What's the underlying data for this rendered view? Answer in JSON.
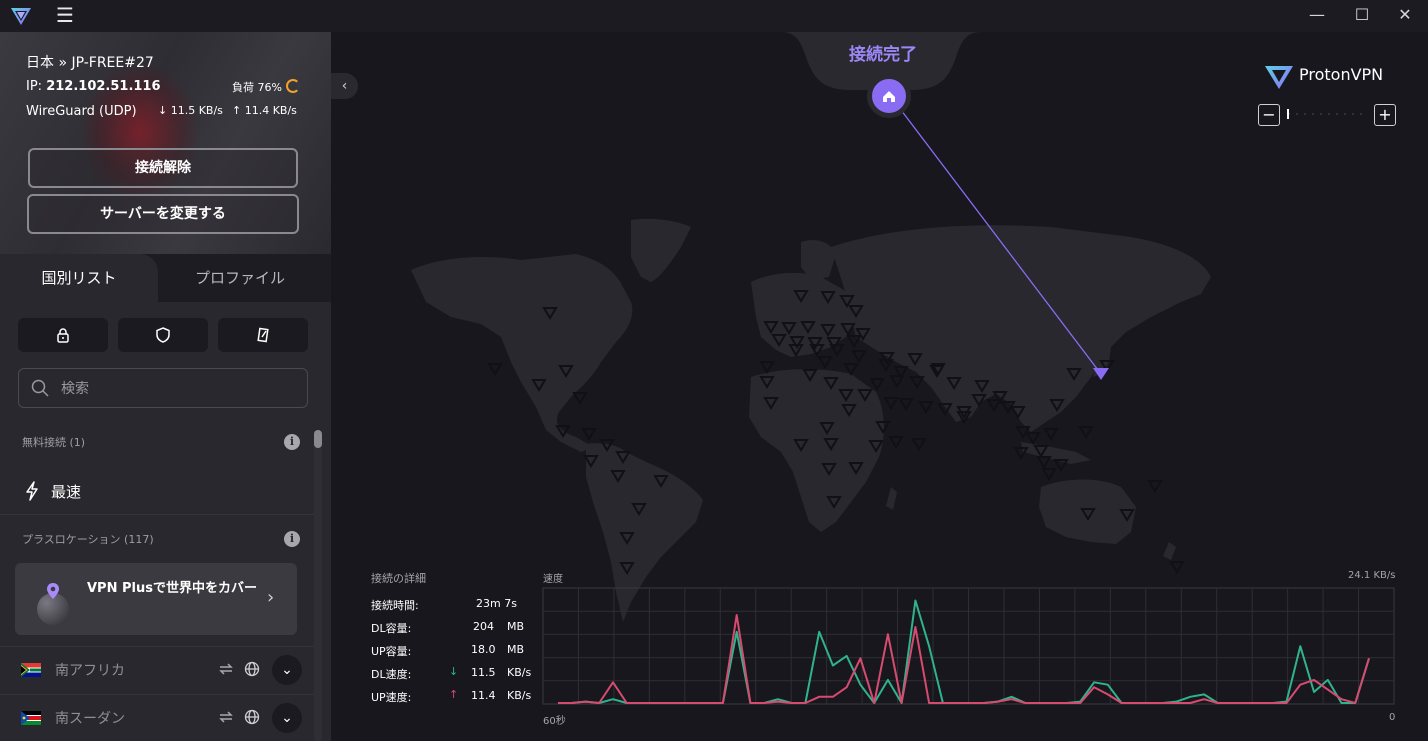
{
  "window": {
    "menu_icon": "hamburger-icon",
    "controls": [
      "minimize-icon",
      "maximize-icon",
      "close-icon"
    ]
  },
  "connection": {
    "server": "日本 » JP-FREE#27",
    "ip_label": "IP:",
    "ip": "212.102.51.116",
    "load_label": "負荷 76%",
    "load_percent": 76,
    "protocol": "WireGuard (UDP)",
    "download_rate": "↓ 11.5 KB/s",
    "upload_rate": "↑ 11.4 KB/s",
    "disconnect_label": "接続解除",
    "change_server_label": "サーバーを変更する"
  },
  "tabs": {
    "countries": "国別リスト",
    "profiles": "プロファイル"
  },
  "filters": [
    "lock-icon",
    "shield-icon",
    "p2p-icon"
  ],
  "search": {
    "placeholder": "検索"
  },
  "free_section": {
    "title": "無料接続 (1)",
    "fastest_label": "最速"
  },
  "plus_section": {
    "title": "プラスロケーション (117)",
    "promo_text": "VPN Plusで世界中をカバー"
  },
  "countries": [
    {
      "name": "南アフリカ"
    },
    {
      "name": "南スーダン"
    }
  ],
  "map": {
    "status": "接続完了",
    "brand": "ProtonVPN",
    "accent_color": "#8a6cf4"
  },
  "details": {
    "title": "接続の詳細",
    "duration_label": "接続時間:",
    "duration": "23m 7s",
    "dl_volume_label": "DL容量:",
    "dl_volume": "204",
    "dl_volume_unit": "MB",
    "ul_volume_label": "UP容量:",
    "ul_volume": "18.0",
    "ul_volume_unit": "MB",
    "dl_speed_label": "DL速度:",
    "dl_speed": "11.5",
    "dl_speed_unit": "KB/s",
    "ul_speed_label": "UP速度:",
    "ul_speed": "11.4",
    "ul_speed_unit": "KB/s"
  },
  "chart_data": {
    "type": "line",
    "title": "速度",
    "xlabel": "",
    "ylabel": "",
    "x_start_label": "60秒",
    "x_end_label": "0",
    "y_max_label": "24.1 KB/s",
    "ylim": [
      0,
      24.1
    ],
    "grid": true,
    "series": [
      {
        "color": "#2fb38c",
        "values": [
          0.2,
          0.2,
          0.5,
          0.2,
          1.0,
          0.2,
          0.2,
          0.2,
          0.2,
          0.2,
          0.2,
          0.2,
          0.2,
          15.0,
          0.2,
          0.2,
          1.0,
          0.2,
          0.2,
          15.0,
          8.0,
          10.0,
          4.0,
          0.2,
          5.0,
          0.2,
          21.5,
          12.0,
          0.2,
          0.2,
          0.2,
          0.2,
          0.5,
          1.5,
          0.2,
          0.2,
          0.2,
          0.2,
          0.5,
          4.5,
          4.0,
          0.2,
          0.2,
          0.2,
          0.2,
          0.5,
          1.5,
          2.0,
          0.2,
          0.2,
          0.2,
          0.2,
          0.2,
          0.5,
          12.0,
          2.5,
          5.0,
          0.2,
          0.2,
          9.5
        ]
      },
      {
        "color": "#d64b6f",
        "values": [
          0.2,
          0.2,
          0.5,
          0.2,
          4.5,
          0.2,
          0.2,
          0.2,
          0.2,
          0.2,
          0.2,
          0.2,
          0.2,
          18.5,
          0.2,
          0.2,
          0.5,
          0.2,
          0.2,
          1.5,
          1.5,
          3.5,
          9.5,
          0.2,
          14.5,
          0.2,
          16.0,
          0.2,
          0.2,
          0.2,
          0.2,
          0.2,
          0.5,
          1.0,
          0.2,
          0.2,
          0.2,
          0.2,
          0.2,
          3.5,
          2.0,
          0.2,
          0.2,
          0.2,
          0.2,
          0.2,
          0.2,
          1.0,
          0.2,
          0.2,
          0.2,
          0.2,
          0.2,
          0.2,
          4.0,
          5.0,
          3.0,
          1.0,
          0.2,
          9.5
        ]
      }
    ]
  }
}
